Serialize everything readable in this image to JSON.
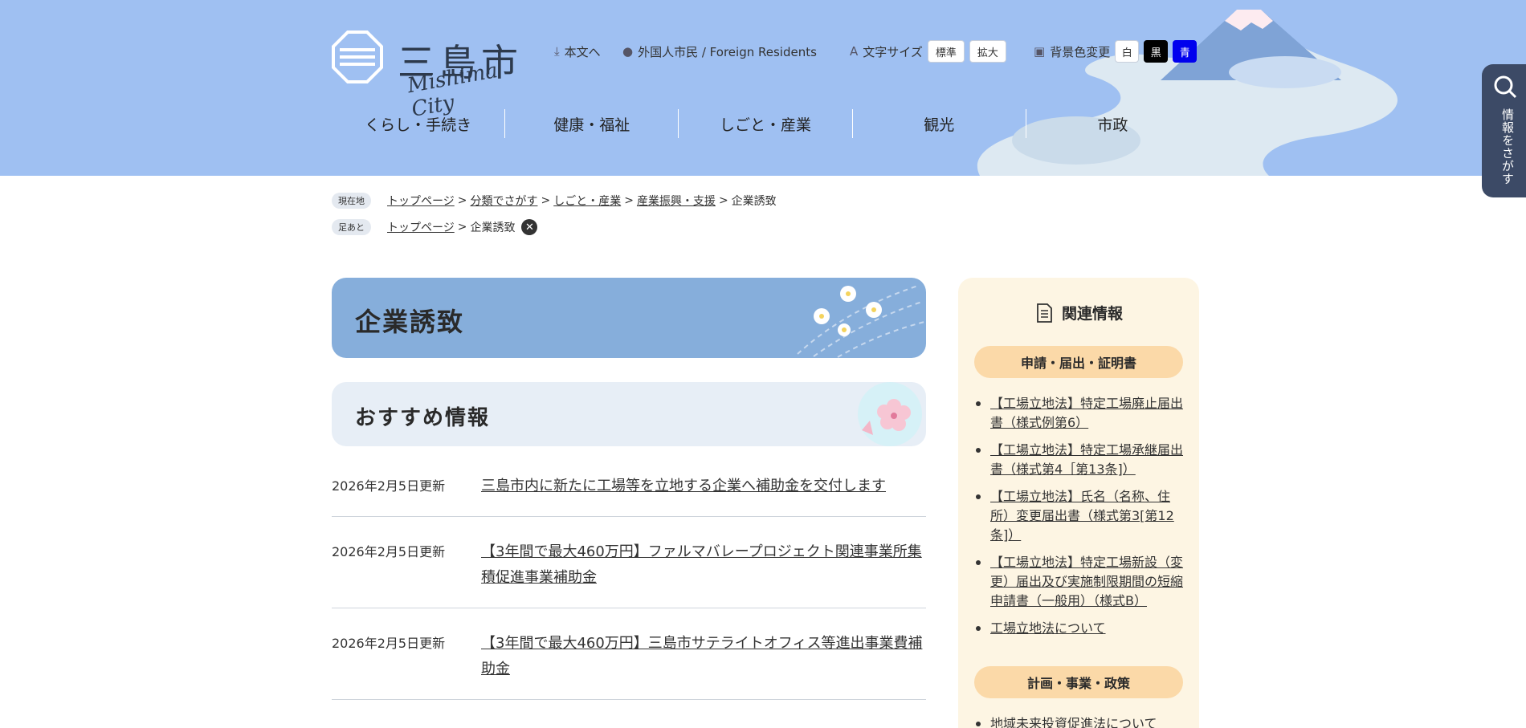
{
  "header": {
    "logo_text": "三島市",
    "logo_sub": "Mishima City",
    "skip_link": "本文へ",
    "foreign_link": "外国人市民 / Foreign Residents",
    "font_size_label": "文字サイズ",
    "font_standard": "標準",
    "font_large": "拡大",
    "bg_color_label": "背景色変更",
    "bg_white": "白",
    "bg_black": "黒",
    "bg_blue": "青"
  },
  "gnav": [
    "くらし・手続き",
    "健康・福祉",
    "しごと・産業",
    "観光",
    "市政"
  ],
  "side_search": "情報をさがす",
  "breadcrumb": {
    "current_tag": "現在地",
    "items": [
      "トップページ",
      "分類でさがす",
      "しごと・産業",
      "産業振興・支援"
    ],
    "current": "企業誘致"
  },
  "footprint": {
    "tag": "足あと",
    "items": [
      "トップページ"
    ],
    "current": "企業誘致"
  },
  "page_title": "企業誘致",
  "section_title": "おすすめ情報",
  "news": [
    {
      "date": "2026年2月5日更新",
      "title": "三島市内に新たに工場等を立地する企業へ補助金を交付します"
    },
    {
      "date": "2026年2月5日更新",
      "title": "【3年間で最大460万円】ファルマバレープロジェクト関連事業所集積促進事業補助金"
    },
    {
      "date": "2026年2月5日更新",
      "title": "【3年間で最大460万円】三島市サテライトオフィス等進出事業費補助金"
    }
  ],
  "related": {
    "title": "関連情報",
    "cat1": "申請・届出・証明書",
    "links1": [
      "【工場立地法】特定工場廃止届出書（様式例第6）",
      "【工場立地法】特定工場承継届出書（様式第4［第13条]）",
      "【工場立地法】氏名（名称、住所）変更届出書（様式第3[第12条]）",
      "【工場立地法】特定工場新設（変更）届出及び実施制限期間の短縮申請書（一般用）（様式B）",
      "工場立地法について"
    ],
    "cat2": "計画・事業・政策",
    "links2": [
      "地域未来投資促進法について"
    ]
  }
}
